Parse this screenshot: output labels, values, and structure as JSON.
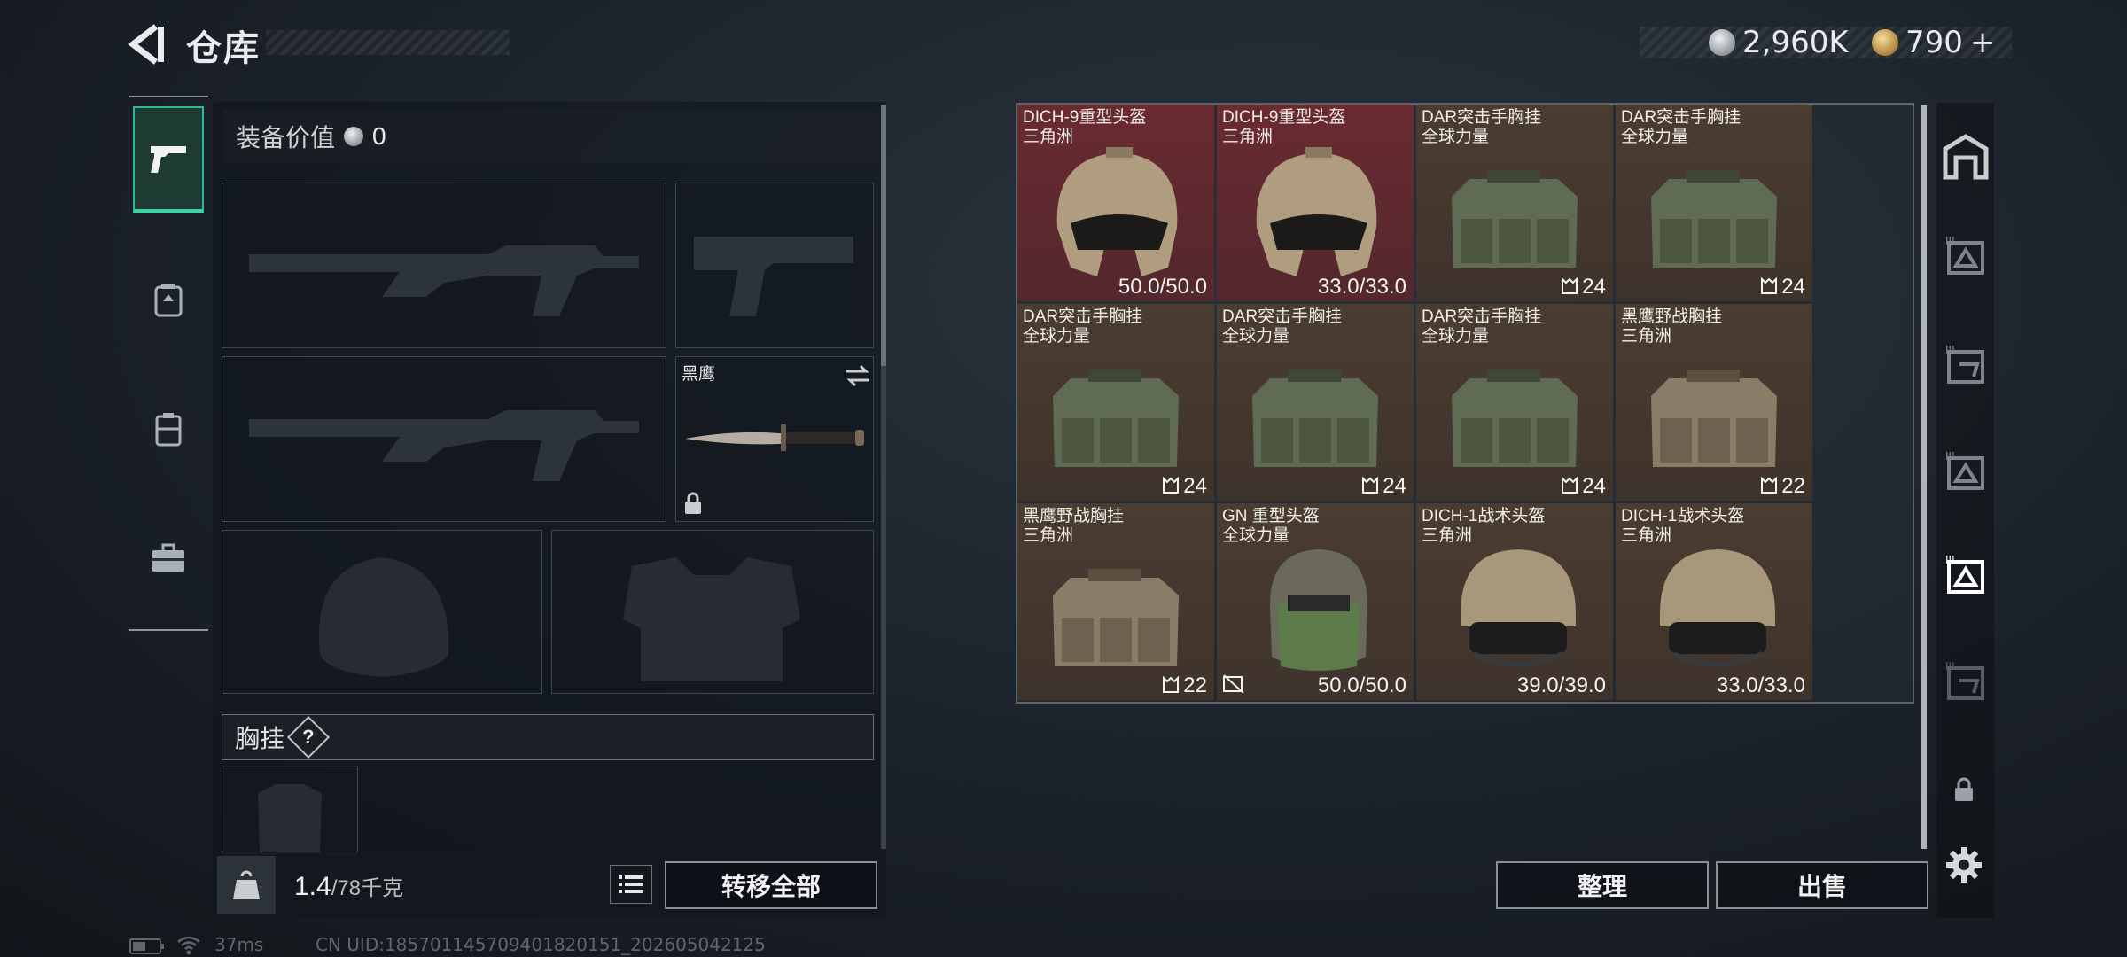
{
  "header": {
    "title": "仓库",
    "currency_silver": "2,960K",
    "currency_gold": "790"
  },
  "loadout": {
    "equipment_value_label": "装备价值",
    "equipment_value": "0",
    "melee_name": "黑鹰",
    "chest_rig_label": "胸挂",
    "chest_rig_help": "?",
    "weight_current": "1.4",
    "weight_max": "/78千克",
    "transfer_all_label": "转移全部"
  },
  "warehouse": {
    "items": [
      {
        "name": "DICH-9重型头盔",
        "map": "三角洲",
        "value": "50.0/50.0",
        "bg": "red",
        "kind": "helmet-heavy"
      },
      {
        "name": "DICH-9重型头盔",
        "map": "三角洲",
        "value": "33.0/33.0",
        "bg": "red",
        "kind": "helmet-heavy"
      },
      {
        "name": "DAR突击手胸挂",
        "map": "全球力量",
        "value": "24",
        "bg": "brown",
        "kind": "rig-green"
      },
      {
        "name": "DAR突击手胸挂",
        "map": "全球力量",
        "value": "24",
        "bg": "brown",
        "kind": "rig-green"
      },
      {
        "name": "DAR突击手胸挂",
        "map": "全球力量",
        "value": "24",
        "bg": "brown",
        "kind": "rig-green"
      },
      {
        "name": "DAR突击手胸挂",
        "map": "全球力量",
        "value": "24",
        "bg": "brown",
        "kind": "rig-green"
      },
      {
        "name": "DAR突击手胸挂",
        "map": "全球力量",
        "value": "24",
        "bg": "brown",
        "kind": "rig-green"
      },
      {
        "name": "黑鹰野战胸挂",
        "map": "三角洲",
        "value": "22",
        "bg": "brown",
        "kind": "rig-tan"
      },
      {
        "name": "黑鹰野战胸挂",
        "map": "三角洲",
        "value": "22",
        "bg": "brown",
        "kind": "rig-tan"
      },
      {
        "name": "GN 重型头盔",
        "map": "全球力量",
        "value": "50.0/50.0",
        "bg": "brown",
        "kind": "helmet-gn"
      },
      {
        "name": "DICH-1战术头盔",
        "map": "三角洲",
        "value": "39.0/39.0",
        "bg": "brown",
        "kind": "helmet-tac"
      },
      {
        "name": "DICH-1战术头盔",
        "map": "三角洲",
        "value": "33.0/33.0",
        "bg": "brown",
        "kind": "helmet-tac"
      }
    ],
    "sort_label": "整理",
    "sell_label": "出售"
  },
  "footer": {
    "ping": "37ms",
    "uid": "CN UID:185701145709401820151_202605042125"
  },
  "colors": {
    "accent": "#3fd2a8",
    "item_red": "#6a2a31",
    "item_brown": "#4b3c31"
  }
}
